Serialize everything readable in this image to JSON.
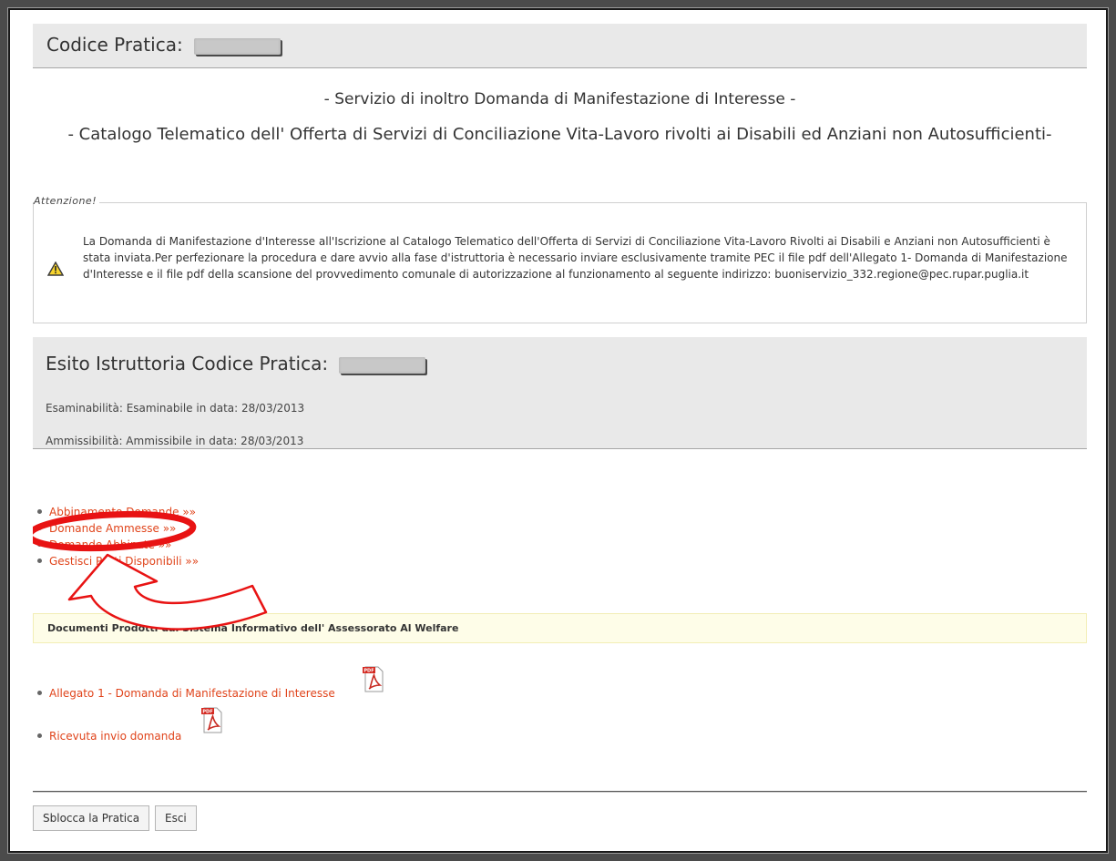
{
  "header": {
    "title": "Codice Pratica:"
  },
  "service": {
    "line1": "- Servizio di inoltro Domanda di Manifestazione di Interesse -",
    "line2": "- Catalogo Telematico dell' Offerta di Servizi di Conciliazione Vita-Lavoro rivolti ai Disabili ed Anziani non Autosufficienti-"
  },
  "attention": {
    "legend": "Attenzione!",
    "icon": "warning-icon",
    "text": "La Domanda di Manifestazione d'Interesse all'Iscrizione al Catalogo Telematico dell'Offerta di Servizi di Conciliazione Vita-Lavoro Rivolti ai Disabili e Anziani non Autosufficienti è stata inviata.Per perfezionare la procedura e dare avvio alla fase d'istruttoria è necessario inviare esclusivamente tramite PEC il file pdf dell'Allegato 1- Domanda di Manifestazione d'Interesse e il file pdf della scansione del provvedimento comunale di autorizzazione al funzionamento al seguente indirizzo: buoniservizio_332.regione@pec.rupar.puglia.it"
  },
  "esito": {
    "title": "Esito Istruttoria Codice Pratica:",
    "esaminabilita": "Esaminabilità: Esaminabile in data: 28/03/2013",
    "ammissibilita": "Ammissibilità: Ammissibile in data: 28/03/2013"
  },
  "links": [
    {
      "label": "Abbinamento Domande »»"
    },
    {
      "label": "Domande Ammesse »»"
    },
    {
      "label": "Domande Abbinate »»"
    },
    {
      "label": "Gestisci Posti Disponibili »»"
    }
  ],
  "documents": {
    "header": "Documenti Prodotti dal Sistema Informativo dell' Assessorato Al Welfare",
    "items": [
      {
        "label": "Allegato 1 - Domanda di Manifestazione di Interesse",
        "icon": "pdf-icon"
      },
      {
        "label": "Ricevuta invio domanda",
        "icon": "pdf-icon"
      }
    ]
  },
  "buttons": {
    "unlock": "Sblocca la Pratica",
    "exit": "Esci"
  },
  "colors": {
    "link": "#e0441b",
    "annotation": "#e81313",
    "header_bg": "#e9e9e9",
    "doc_bar_bg": "#fefde8"
  }
}
